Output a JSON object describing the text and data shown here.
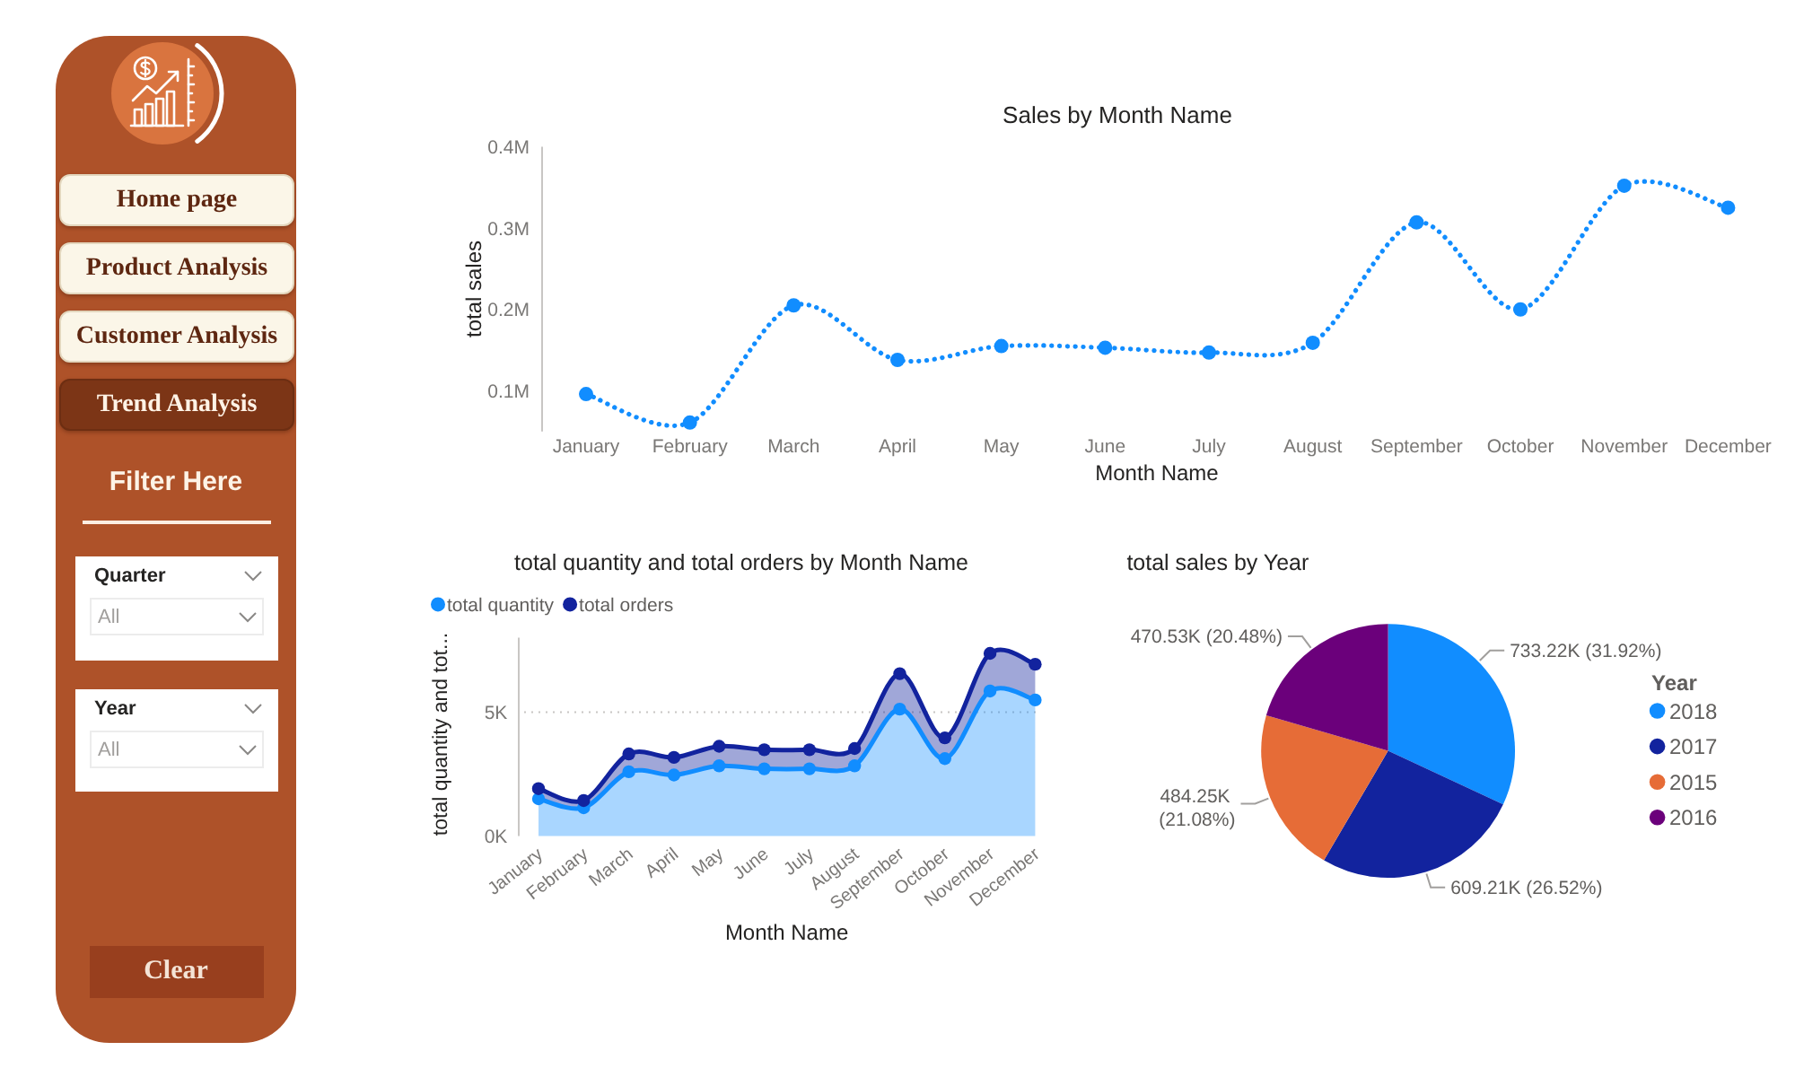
{
  "sidebar": {
    "nav": [
      {
        "label": "Home page",
        "selected": false
      },
      {
        "label": "Product Analysis",
        "selected": false
      },
      {
        "label": "Customer Analysis",
        "selected": false
      },
      {
        "label": "Trend Analysis",
        "selected": true
      }
    ],
    "filter_heading": "Filter Here",
    "slicers": [
      {
        "label": "Quarter",
        "value": "All"
      },
      {
        "label": "Year",
        "value": "All"
      }
    ],
    "clear_button": "Clear"
  },
  "sales_chart": {
    "chart_data": {
      "type": "line",
      "title": "Sales by Month Name",
      "xlabel": "Month Name",
      "ylabel": "total sales",
      "categories": [
        "January",
        "February",
        "March",
        "April",
        "May",
        "June",
        "July",
        "August",
        "September",
        "October",
        "November",
        "December"
      ],
      "values": [
        96000,
        61000,
        205000,
        138000,
        155000,
        153000,
        147000,
        159000,
        307000,
        200000,
        352000,
        325000
      ],
      "color": "#118dff",
      "line_style": "dotted",
      "marker": "circle",
      "ylim": [
        50000,
        400000
      ],
      "yticks": [
        {
          "value": 100000,
          "label": "0.1M"
        },
        {
          "value": 200000,
          "label": "0.2M"
        },
        {
          "value": 300000,
          "label": "0.3M"
        },
        {
          "value": 400000,
          "label": "0.4M"
        }
      ]
    }
  },
  "quantity_orders_chart": {
    "chart_data": {
      "type": "area",
      "title": "total quantity and total orders by Month Name",
      "xlabel": "Month Name",
      "ylabel": "total quantity and tot...",
      "categories": [
        "January",
        "February",
        "March",
        "April",
        "May",
        "June",
        "July",
        "August",
        "September",
        "October",
        "November",
        "December"
      ],
      "series": [
        {
          "name": "total quantity",
          "color": "#118dff",
          "values": [
            1500,
            1140,
            2590,
            2460,
            2830,
            2710,
            2710,
            2830,
            5120,
            3120,
            5850,
            5490
          ]
        },
        {
          "name": "total orders",
          "color": "#12239e",
          "values": [
            410,
            290,
            720,
            710,
            790,
            770,
            770,
            700,
            1430,
            840,
            1520,
            1440
          ]
        }
      ],
      "stacked": true,
      "legend": true,
      "ylim": [
        0,
        8000
      ],
      "yticks": [
        {
          "value": 0,
          "label": "0K"
        },
        {
          "value": 5000,
          "label": "5K"
        }
      ]
    }
  },
  "sales_by_year_chart": {
    "chart_data": {
      "type": "pie",
      "title": "total sales by Year",
      "categories": [
        "2018",
        "2017",
        "2015",
        "2016"
      ],
      "values": [
        733220,
        609210,
        484250,
        470530
      ],
      "colors": [
        "#118dff",
        "#12239e",
        "#e66c37",
        "#6b007b"
      ],
      "value_labels": [
        "733.22K (31.92%)",
        "609.21K (26.52%)",
        "484.25K (21.08%)",
        "470.53K (20.48%)"
      ],
      "legend": {
        "title": "Year"
      }
    }
  }
}
